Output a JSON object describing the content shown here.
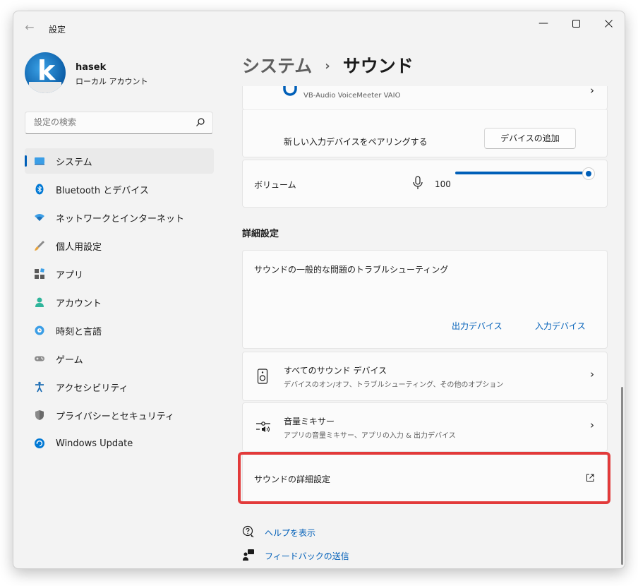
{
  "window": {
    "title": "設定"
  },
  "user": {
    "name": "hasek",
    "account_type": "ローカル アカウント"
  },
  "search": {
    "placeholder": "設定の検索"
  },
  "sidebar": {
    "items": [
      {
        "label": "システム",
        "icon": "system-icon",
        "active": true
      },
      {
        "label": "Bluetooth とデバイス",
        "icon": "bluetooth-icon"
      },
      {
        "label": "ネットワークとインターネット",
        "icon": "wifi-icon"
      },
      {
        "label": "個人用設定",
        "icon": "brush-icon"
      },
      {
        "label": "アプリ",
        "icon": "apps-icon"
      },
      {
        "label": "アカウント",
        "icon": "person-icon"
      },
      {
        "label": "時刻と言語",
        "icon": "globe-clock-icon"
      },
      {
        "label": "ゲーム",
        "icon": "gamepad-icon"
      },
      {
        "label": "アクセシビリティ",
        "icon": "accessibility-icon"
      },
      {
        "label": "プライバシーとセキュリティ",
        "icon": "shield-icon"
      },
      {
        "label": "Windows Update",
        "icon": "update-icon"
      }
    ]
  },
  "breadcrumb": {
    "parent": "システム",
    "current": "サウンド"
  },
  "input_device": {
    "name": "VB-Audio VoiceMeeter VAIO"
  },
  "pair": {
    "label": "新しい入力デバイスをペアリングする",
    "button": "デバイスの追加"
  },
  "volume": {
    "label": "ボリューム",
    "value": "100",
    "level": 1.0
  },
  "advanced": {
    "header": "詳細設定",
    "troubleshoot": {
      "title": "サウンドの一般的な問題のトラブルシューティング",
      "output_link": "出力デバイス",
      "input_link": "入力デバイス"
    },
    "all_devices": {
      "title": "すべてのサウンド デバイス",
      "subtitle": "デバイスのオン/オフ、トラブルシューティング、その他のオプション"
    },
    "mixer": {
      "title": "音量ミキサー",
      "subtitle": "アプリの音量ミキサー、アプリの入力 & 出力デバイス"
    },
    "more": {
      "title": "サウンドの詳細設定"
    }
  },
  "footer": {
    "help": "ヘルプを表示",
    "feedback": "フィードバックの送信"
  },
  "colors": {
    "accent": "#005fb8",
    "highlight": "#e23a3a"
  }
}
